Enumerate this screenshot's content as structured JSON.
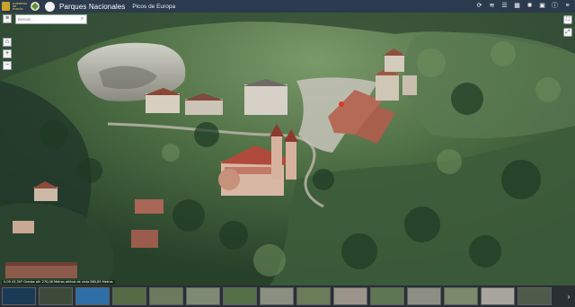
{
  "header": {
    "gov_text": "GOBIERNO DE ESPAÑA",
    "brand_title": "Parques Nacionales",
    "park_name": "Picos de Europa",
    "tools": [
      {
        "icon": "share-icon",
        "glyph": "⟳"
      },
      {
        "icon": "layers-icon",
        "glyph": "≋"
      },
      {
        "icon": "list-icon",
        "glyph": "☰"
      },
      {
        "icon": "grid-icon",
        "glyph": "▦"
      },
      {
        "icon": "sun-icon",
        "glyph": "✺"
      },
      {
        "icon": "gallery-icon",
        "glyph": "▣"
      },
      {
        "icon": "info-icon",
        "glyph": "ⓘ"
      },
      {
        "icon": "menu-icon",
        "glyph": "≡"
      }
    ]
  },
  "search": {
    "placeholder": "Buscar...",
    "value": "",
    "icon": "search-icon"
  },
  "nav": [
    {
      "name": "home-button",
      "glyph": "⌂"
    },
    {
      "name": "zoom-in-button",
      "glyph": "+"
    },
    {
      "name": "zoom-out-button",
      "glyph": "−"
    },
    {
      "name": "compass-button",
      "glyph": "◈"
    }
  ],
  "right_widgets": [
    {
      "name": "fullscreen-button",
      "glyph": "⛶"
    },
    {
      "name": "expand-button",
      "glyph": "⤢"
    }
  ],
  "coords": "0,00 43,307 Grados  alt: 270,06 Metros  altitud de vista 880,85 Metros",
  "gallery": {
    "thumb_count": 15,
    "next_glyph": "›"
  },
  "colors": {
    "header_bg": "#2b3a4d",
    "gallery_bg": "#2a2f33"
  }
}
